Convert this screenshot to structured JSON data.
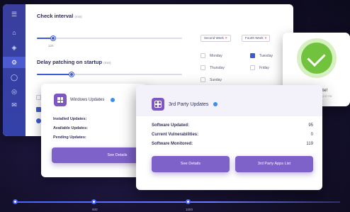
{
  "sidebar": {
    "icons": [
      "menu-icon",
      "home-icon",
      "shield-icon",
      "gear-icon",
      "globe-icon",
      "lifebuoy-icon",
      "mail-icon"
    ]
  },
  "check_interval": {
    "title": "Check interval",
    "unit": "(min)",
    "value_label": "120",
    "level": 0.11
  },
  "week_chips": [
    {
      "label": "Second Week"
    },
    {
      "label": "Fourth Week"
    }
  ],
  "delay": {
    "title": "Delay patching on startup",
    "unit": "(min)",
    "level": 0.24
  },
  "days": [
    {
      "label": "Monday",
      "checked": false
    },
    {
      "label": "Tuesday",
      "checked": true
    },
    {
      "label": "Thursday",
      "checked": false
    },
    {
      "label": "Friday",
      "checked": false
    },
    {
      "label": "Sunday",
      "checked": false
    }
  ],
  "up_to_date": {
    "title": "Up to date!",
    "subtitle": "Last check: Today 12:57 PM"
  },
  "windows_updates": {
    "title": "Windows Updates",
    "rows": [
      {
        "label": "Installed Updates:"
      },
      {
        "label": "Available Updates:"
      },
      {
        "label": "Pending Updates:"
      }
    ],
    "button": "See Details"
  },
  "third_party": {
    "title": "3rd Party Updates",
    "rows": [
      {
        "label": "Software Updated:",
        "value": "95"
      },
      {
        "label": "Current Vulnerabilities:",
        "value": "0"
      },
      {
        "label": "Software Monitored:",
        "value": "119"
      }
    ],
    "see_details": "See Details",
    "apps_list": "3rd Party Apps List"
  },
  "timeline": {
    "labels": [
      "800",
      "1000"
    ]
  },
  "colors": {
    "sidebar": "#3a3f9e",
    "accent": "#3b5bd6",
    "purple": "#7e62c9",
    "green": "#71c23c"
  }
}
